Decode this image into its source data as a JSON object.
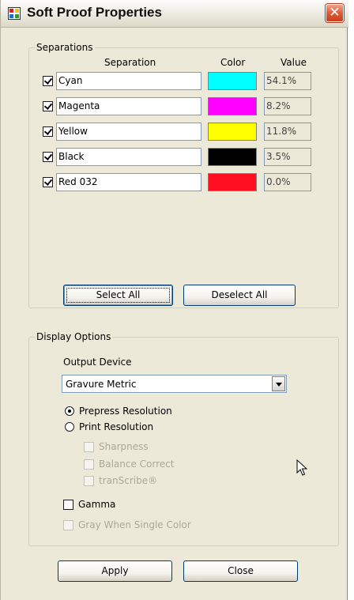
{
  "window": {
    "title": "Soft Proof Properties",
    "close_glyph": "✕"
  },
  "separations": {
    "group_label": "Separations",
    "headers": {
      "separation": "Separation",
      "color": "Color",
      "value": "Value"
    },
    "rows": [
      {
        "name": "Cyan",
        "color": "#00ffff",
        "value": "54.1%",
        "checked": true
      },
      {
        "name": "Magenta",
        "color": "#ff00ff",
        "value": "8.2%",
        "checked": true
      },
      {
        "name": "Yellow",
        "color": "#ffff00",
        "value": "11.8%",
        "checked": true
      },
      {
        "name": "Black",
        "color": "#000000",
        "value": "3.5%",
        "checked": true
      },
      {
        "name": "Red 032",
        "color": "#ff0f1f",
        "value": "0.0%",
        "checked": true
      }
    ],
    "select_all_label": "Select All",
    "deselect_all_label": "Deselect All"
  },
  "display_options": {
    "group_label": "Display Options",
    "output_device_label": "Output Device",
    "output_device_value": "Gravure Metric",
    "prepress_resolution_label": "Prepress Resolution",
    "print_resolution_label": "Print Resolution",
    "sharpness_label": "Sharpness",
    "balance_correct_label": "Balance Correct",
    "transcribe_label": "tranScribe®",
    "gamma_label": "Gamma",
    "gray_single_color_label": "Gray When Single Color"
  },
  "footer": {
    "apply_label": "Apply",
    "close_label": "Close"
  }
}
